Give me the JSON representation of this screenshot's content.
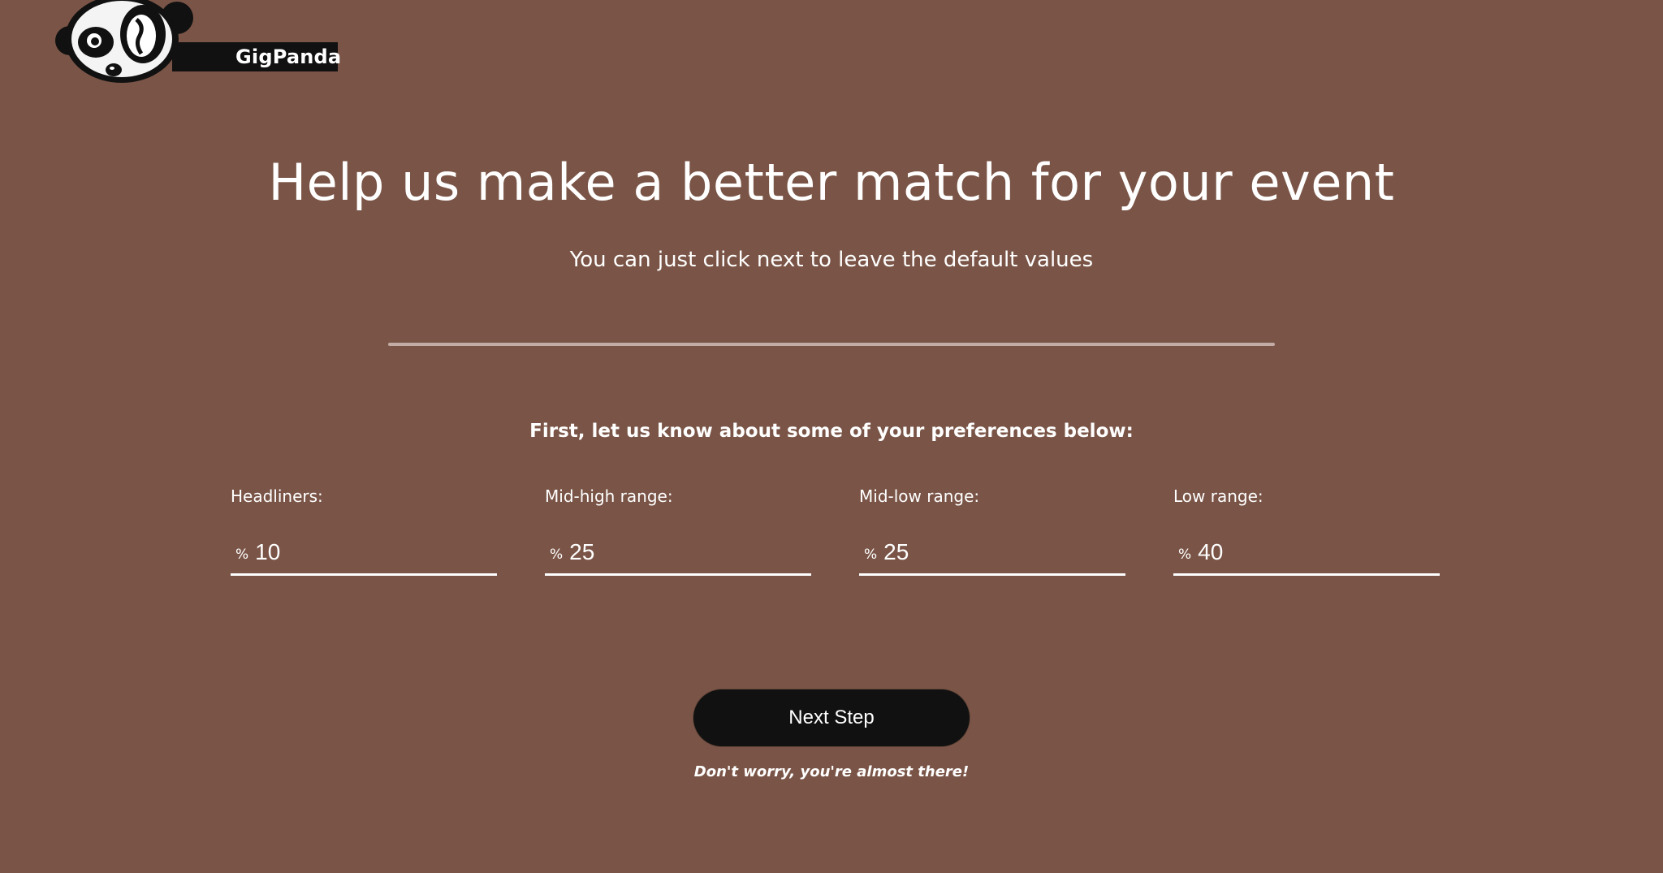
{
  "brand": {
    "name": "GigPanda"
  },
  "header": {
    "title": "Help us make a better match for your event",
    "subtitle": "You can just click next to leave the default values"
  },
  "preferences": {
    "heading": "First, let us know about some of your preferences below:",
    "unit_symbol": "%",
    "fields": [
      {
        "label": "Headliners:",
        "value": "10"
      },
      {
        "label": "Mid-high range:",
        "value": "25"
      },
      {
        "label": "Mid-low range:",
        "value": "25"
      },
      {
        "label": "Low range:",
        "value": "40"
      }
    ]
  },
  "actions": {
    "next_label": "Next Step",
    "hint": "Don't worry, you're almost there!"
  },
  "colors": {
    "background": "#7a5547",
    "button": "#111111",
    "text": "#ffffff",
    "divider": "#c2aca5"
  }
}
